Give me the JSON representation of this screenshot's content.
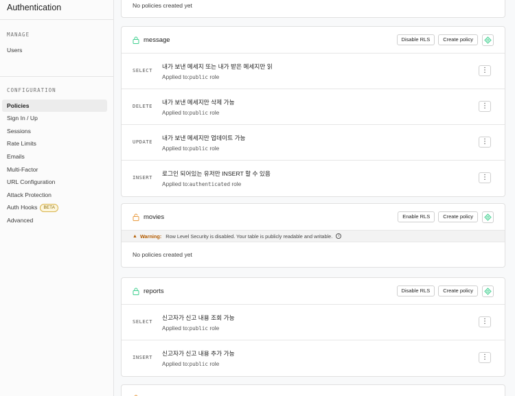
{
  "sidebar": {
    "title": "Authentication",
    "manage_heading": "MANAGE",
    "manage_items": [
      {
        "label": "Users"
      }
    ],
    "config_heading": "CONFIGURATION",
    "config_items": [
      {
        "label": "Policies",
        "active": true
      },
      {
        "label": "Sign In / Up"
      },
      {
        "label": "Sessions"
      },
      {
        "label": "Rate Limits"
      },
      {
        "label": "Emails"
      },
      {
        "label": "Multi-Factor"
      },
      {
        "label": "URL Configuration"
      },
      {
        "label": "Attack Protection"
      },
      {
        "label": "Auth Hooks",
        "badge": "BETA"
      },
      {
        "label": "Advanced"
      }
    ]
  },
  "top_card": {
    "empty_text": "No policies created yet"
  },
  "tables": [
    {
      "name": "message",
      "rls_enabled": true,
      "rls_button": "Disable RLS",
      "create_button": "Create policy",
      "policies": [
        {
          "command": "SELECT",
          "name": "내가 보낸 메세지 또는 내가 받은 메세지만 읽",
          "applied_prefix": "Applied to:",
          "role": "public",
          "role_suffix": " role"
        },
        {
          "command": "DELETE",
          "name": "내가 보낸 메세지만 삭제 가능",
          "applied_prefix": "Applied to:",
          "role": "public",
          "role_suffix": " role"
        },
        {
          "command": "UPDATE",
          "name": "내가 보낸 메세지만 업데이트 가능",
          "applied_prefix": "Applied to:",
          "role": "public",
          "role_suffix": " role"
        },
        {
          "command": "INSERT",
          "name": "로그인 되어있는 유저만 INSERT 할 수 있음",
          "applied_prefix": "Applied to:",
          "role": "authenticated",
          "role_suffix": " role"
        }
      ]
    },
    {
      "name": "movies",
      "rls_enabled": false,
      "rls_button": "Enable RLS",
      "create_button": "Create policy",
      "warning_label": "Warning:",
      "warning_text": "Row Level Security is disabled. Your table is publicly readable and writable.",
      "empty_text": "No policies created yet"
    },
    {
      "name": "reports",
      "rls_enabled": true,
      "rls_button": "Disable RLS",
      "create_button": "Create policy",
      "policies": [
        {
          "command": "SELECT",
          "name": "신고자가 신고 내용 조회 가능",
          "applied_prefix": "Applied to:",
          "role": "public",
          "role_suffix": " role"
        },
        {
          "command": "INSERT",
          "name": "신고자가 신고 내용 추가 가능",
          "applied_prefix": "Applied to:",
          "role": "public",
          "role_suffix": " role"
        }
      ]
    },
    {
      "name": "",
      "rls_enabled": false,
      "rls_button": "",
      "create_button": ""
    }
  ],
  "colors": {
    "lock_green": "#3ecf8e",
    "lock_orange": "#e8993d",
    "warning": "#b35c00"
  },
  "icons": {
    "lock": "lock-icon",
    "shield": "shield-icon",
    "more": "more-vertical-icon",
    "info": "info-icon"
  }
}
